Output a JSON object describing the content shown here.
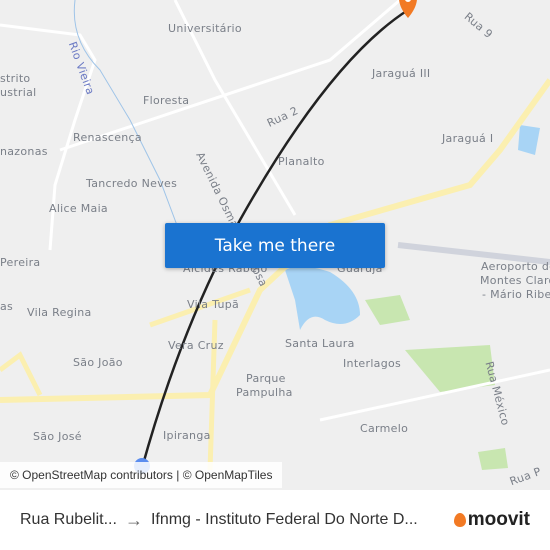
{
  "map": {
    "labels": [
      {
        "text": "Universitário",
        "cls": ""
      },
      {
        "text": "strito",
        "cls": ""
      },
      {
        "text": "ustrial",
        "cls": ""
      },
      {
        "text": "Floresta",
        "cls": ""
      },
      {
        "text": "Renascença",
        "cls": ""
      },
      {
        "text": "nazonas",
        "cls": ""
      },
      {
        "text": "Tancredo Neves",
        "cls": ""
      },
      {
        "text": "Alice Maia",
        "cls": ""
      },
      {
        "text": "Rio Vieira",
        "cls": "river"
      },
      {
        "text": "Avenida Osmane Barbosa",
        "cls": ""
      },
      {
        "text": "Rua 2",
        "cls": ""
      },
      {
        "text": "Planalto",
        "cls": ""
      },
      {
        "text": "Jaraguá III",
        "cls": ""
      },
      {
        "text": "Jaraguá I",
        "cls": ""
      },
      {
        "text": "Rua 9",
        "cls": ""
      },
      {
        "text": "Pereira",
        "cls": ""
      },
      {
        "text": "Vila Regina",
        "cls": ""
      },
      {
        "text": "Alcides Rabelo",
        "cls": ""
      },
      {
        "text": "Guarujá",
        "cls": ""
      },
      {
        "text": "Vila Tupã",
        "cls": ""
      },
      {
        "text": "Vera Cruz",
        "cls": ""
      },
      {
        "text": "São João",
        "cls": ""
      },
      {
        "text": "Santa Laura",
        "cls": ""
      },
      {
        "text": "Interlagos",
        "cls": ""
      },
      {
        "text": "Parque",
        "cls": ""
      },
      {
        "text": "Pampulha",
        "cls": ""
      },
      {
        "text": "São José",
        "cls": ""
      },
      {
        "text": "Ipiranga",
        "cls": ""
      },
      {
        "text": "Carmelo",
        "cls": ""
      },
      {
        "text": "Aeroporto de",
        "cls": ""
      },
      {
        "text": "Montes Claros",
        "cls": ""
      },
      {
        "text": "- Mário Ribeiro",
        "cls": ""
      },
      {
        "text": "Rua México",
        "cls": ""
      },
      {
        "text": "Rua P",
        "cls": ""
      },
      {
        "text": "as",
        "cls": ""
      }
    ],
    "cta_label": "Take me there",
    "attribution": "© OpenStreetMap contributors | © OpenMapTiles",
    "colors": {
      "route": "#222222",
      "destination": "#f27a24",
      "origin": "#5b8def",
      "water": "#a8d4f5",
      "park": "#c8e6b0",
      "highway": "#fbefb0"
    }
  },
  "footer": {
    "origin": "Rua Rubelit...",
    "destination": "Ifnmg - Instituto Federal Do Norte D...",
    "brand": "moovit"
  }
}
